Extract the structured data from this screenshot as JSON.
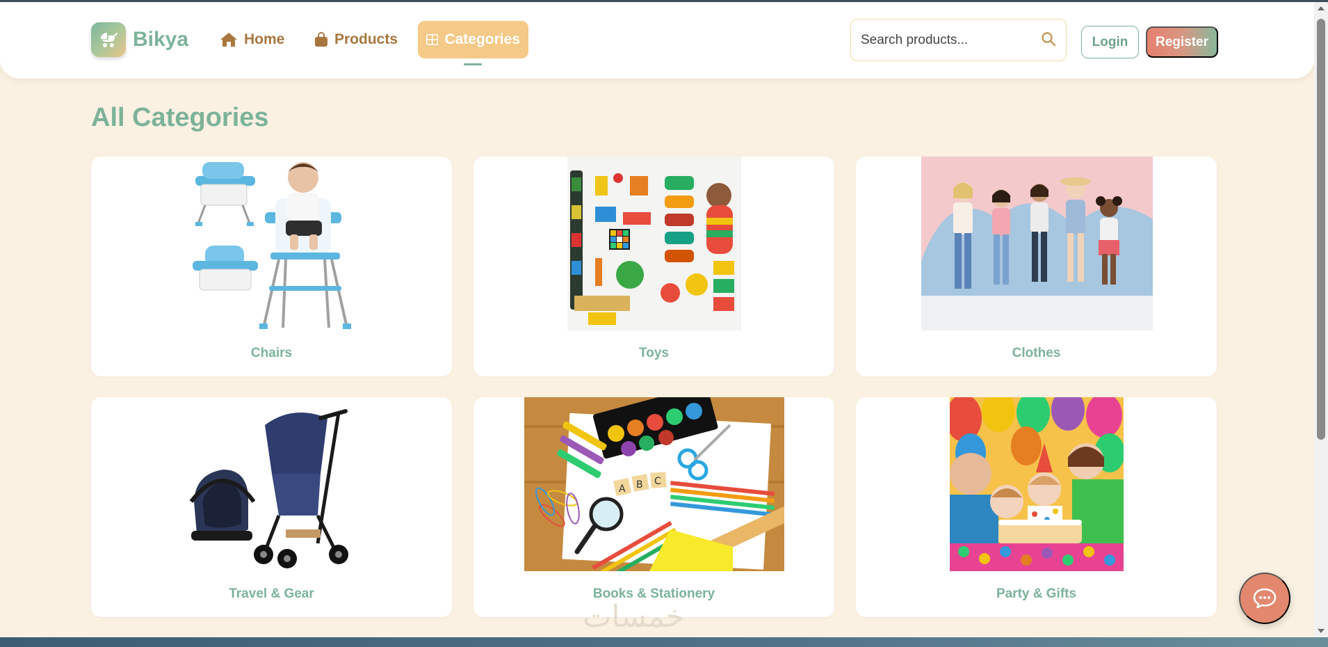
{
  "brand": {
    "name": "Bikya",
    "logo_icon": "baby-carriage-icon"
  },
  "nav": {
    "home": {
      "label": "Home",
      "icon": "house-icon"
    },
    "products": {
      "label": "Products",
      "icon": "shopping-bag-icon"
    },
    "categories": {
      "label": "Categories",
      "icon": "grid-icon",
      "active": true
    }
  },
  "search": {
    "placeholder": "Search products...",
    "value": "",
    "icon": "search-icon"
  },
  "auth": {
    "login_label": "Login",
    "register_label": "Register"
  },
  "page": {
    "title": "All Categories"
  },
  "categories": [
    {
      "label": "Chairs",
      "image": "high-chairs-photo"
    },
    {
      "label": "Toys",
      "image": "toys-flatlay-photo"
    },
    {
      "label": "Clothes",
      "image": "kids-clothes-photo"
    },
    {
      "label": "Travel & Gear",
      "image": "stroller-carseat-photo"
    },
    {
      "label": "Books & Stationery",
      "image": "stationery-photo"
    },
    {
      "label": "Party & Gifts",
      "image": "birthday-party-photo"
    }
  ],
  "chat": {
    "icon": "chat-bubble-icon"
  },
  "watermark": {
    "text": "خمسات"
  },
  "colors": {
    "accent": "#7cb39a",
    "nav_text": "#a8773f",
    "active_tab": "#f5c987",
    "background": "#fbf1e2",
    "chat": "#e3886e"
  }
}
